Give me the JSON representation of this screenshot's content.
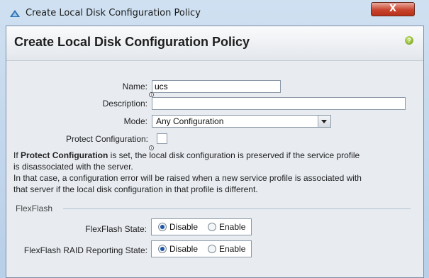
{
  "window": {
    "title": "Create Local Disk Configuration Policy",
    "close_label": "X"
  },
  "header": {
    "title": "Create Local Disk Configuration Policy",
    "help_label": "?"
  },
  "form": {
    "name_label": "Name:",
    "name_value": "ucs",
    "description_label": "Description:",
    "description_value": "",
    "mode_label": "Mode:",
    "mode_value": "Any Configuration",
    "protect_label": "Protect Configuration:",
    "protect_checked": false,
    "info_text": {
      "line1_pre": "If ",
      "line1_bold": "Protect Configuration",
      "line1_post": " is set, the local disk configuration is preserved if the service profile",
      "line2": "is disassociated with the server.",
      "line3": "In that case, a configuration error will be raised when a new service profile is associated with",
      "line4": "that server if the local disk configuration in that profile is different."
    }
  },
  "flexflash": {
    "section_label": "FlexFlash",
    "state_label": "FlexFlash State:",
    "state_options": [
      "Disable",
      "Enable"
    ],
    "state_selected": "Disable",
    "raid_label": "FlexFlash RAID Reporting State:",
    "raid_options": [
      "Disable",
      "Enable"
    ],
    "raid_selected": "Disable"
  }
}
